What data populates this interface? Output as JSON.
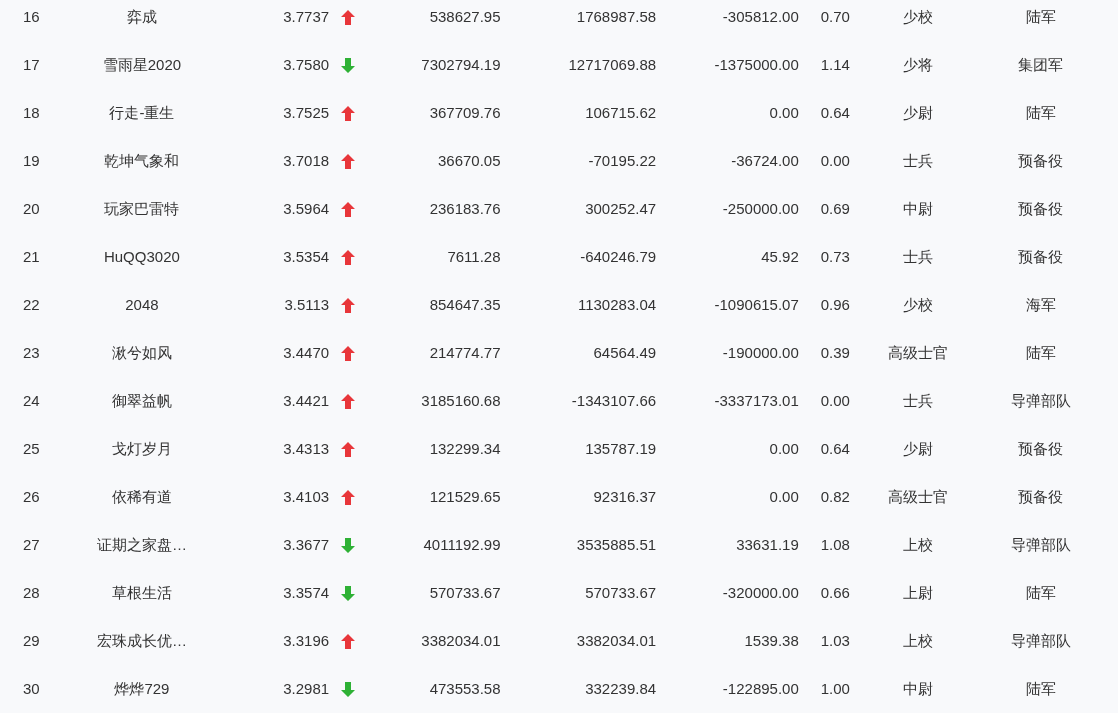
{
  "rows": [
    {
      "rank": "16",
      "name": "弈成",
      "score": "3.7737",
      "rising": true,
      "col_4": "538627.95",
      "col_5": "1768987.58",
      "col_6": "-305812.00",
      "col_7": "0.70",
      "title": "少校",
      "branch": "陆军"
    },
    {
      "rank": "17",
      "name": "雪雨星2020",
      "score": "3.7580",
      "rising": false,
      "col_4": "7302794.19",
      "col_5": "12717069.88",
      "col_6": "-1375000.00",
      "col_7": "1.14",
      "title": "少将",
      "branch": "集团军"
    },
    {
      "rank": "18",
      "name": "行走-重生",
      "score": "3.7525",
      "rising": true,
      "col_4": "367709.76",
      "col_5": "106715.62",
      "col_6": "0.00",
      "col_7": "0.64",
      "title": "少尉",
      "branch": "陆军"
    },
    {
      "rank": "19",
      "name": "乾坤气象和",
      "score": "3.7018",
      "rising": true,
      "col_4": "36670.05",
      "col_5": "-70195.22",
      "col_6": "-36724.00",
      "col_7": "0.00",
      "title": "士兵",
      "branch": "预备役"
    },
    {
      "rank": "20",
      "name": "玩家巴雷特",
      "score": "3.5964",
      "rising": true,
      "col_4": "236183.76",
      "col_5": "300252.47",
      "col_6": "-250000.00",
      "col_7": "0.69",
      "title": "中尉",
      "branch": "预备役"
    },
    {
      "rank": "21",
      "name": "HuQQ3020",
      "score": "3.5354",
      "rising": true,
      "col_4": "7611.28",
      "col_5": "-640246.79",
      "col_6": "45.92",
      "col_7": "0.73",
      "title": "士兵",
      "branch": "预备役"
    },
    {
      "rank": "22",
      "name": "2048",
      "score": "3.5113",
      "rising": true,
      "col_4": "854647.35",
      "col_5": "1130283.04",
      "col_6": "-1090615.07",
      "col_7": "0.96",
      "title": "少校",
      "branch": "海军"
    },
    {
      "rank": "23",
      "name": "湫兮如风",
      "score": "3.4470",
      "rising": true,
      "col_4": "214774.77",
      "col_5": "64564.49",
      "col_6": "-190000.00",
      "col_7": "0.39",
      "title": "高级士官",
      "branch": "陆军"
    },
    {
      "rank": "24",
      "name": "御翠益帆",
      "score": "3.4421",
      "rising": true,
      "col_4": "3185160.68",
      "col_5": "-1343107.66",
      "col_6": "-3337173.01",
      "col_7": "0.00",
      "title": "士兵",
      "branch": "导弹部队"
    },
    {
      "rank": "25",
      "name": "戈灯岁月",
      "score": "3.4313",
      "rising": true,
      "col_4": "132299.34",
      "col_5": "135787.19",
      "col_6": "0.00",
      "col_7": "0.64",
      "title": "少尉",
      "branch": "预备役"
    },
    {
      "rank": "26",
      "name": "依稀有道",
      "score": "3.4103",
      "rising": true,
      "col_4": "121529.65",
      "col_5": "92316.37",
      "col_6": "0.00",
      "col_7": "0.82",
      "title": "高级士官",
      "branch": "预备役"
    },
    {
      "rank": "27",
      "name": "证期之家盘…",
      "score": "3.3677",
      "rising": false,
      "col_4": "4011192.99",
      "col_5": "3535885.51",
      "col_6": "33631.19",
      "col_7": "1.08",
      "title": "上校",
      "branch": "导弹部队"
    },
    {
      "rank": "28",
      "name": "草根生活",
      "score": "3.3574",
      "rising": false,
      "col_4": "570733.67",
      "col_5": "570733.67",
      "col_6": "-320000.00",
      "col_7": "0.66",
      "title": "上尉",
      "branch": "陆军"
    },
    {
      "rank": "29",
      "name": "宏珠成长优…",
      "score": "3.3196",
      "rising": true,
      "col_4": "3382034.01",
      "col_5": "3382034.01",
      "col_6": "1539.38",
      "col_7": "1.03",
      "title": "上校",
      "branch": "导弹部队"
    },
    {
      "rank": "30",
      "name": "烨烨729",
      "score": "3.2981",
      "rising": false,
      "col_4": "473553.58",
      "col_5": "332239.84",
      "col_6": "-122895.00",
      "col_7": "1.00",
      "title": "中尉",
      "branch": "陆军"
    }
  ]
}
